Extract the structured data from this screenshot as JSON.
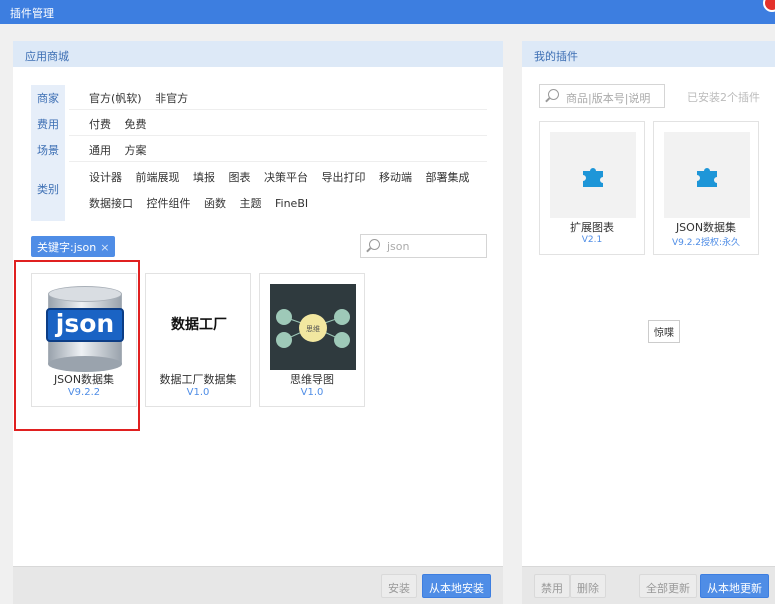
{
  "window": {
    "title": "插件管理"
  },
  "store": {
    "header": "应用商城",
    "filters": [
      {
        "key": "商家",
        "values": [
          "官方(帆软)",
          "非官方"
        ]
      },
      {
        "key": "费用",
        "values": [
          "付费",
          "免费"
        ]
      },
      {
        "key": "场景",
        "values": [
          "通用",
          "方案"
        ]
      },
      {
        "key": "类别",
        "values": [
          "设计器",
          "前端展现",
          "填报",
          "图表",
          "决策平台",
          "导出打印",
          "移动端",
          "部署集成"
        ],
        "values2": [
          "数据接口",
          "控件组件",
          "函数",
          "主题",
          "FineBI"
        ]
      }
    ],
    "keyword_tag": "关键字:json",
    "keyword_close": "×",
    "search_value": "json",
    "plugins": [
      {
        "name": "JSON数据集",
        "version": "V9.2.2",
        "icon": "json-database-icon",
        "thumb_text": "json"
      },
      {
        "name": "数据工厂数据集",
        "version": "V1.0",
        "icon": "data-factory-logo",
        "thumb_text": "数据工厂"
      },
      {
        "name": "思维导图",
        "version": "V1.0",
        "icon": "mind-map-icon",
        "thumb_text": "思维"
      }
    ],
    "footer": {
      "install": "安装",
      "install_local": "从本地安装"
    }
  },
  "mine": {
    "header": "我的插件",
    "search_placeholder": "商品|版本号|说明",
    "installed_count": "已安装2个插件",
    "plugins": [
      {
        "name": "扩展图表",
        "version": "V2.1",
        "icon": "puzzle-icon"
      },
      {
        "name": "JSON数据集",
        "version": "V9.2.2授权:永久",
        "icon": "puzzle-icon"
      }
    ],
    "tooltip": "惊喋",
    "footer": {
      "disable": "禁用",
      "delete": "删除",
      "update_all": "全部更新",
      "update_local": "从本地更新"
    }
  },
  "colors": {
    "accent": "#4f8de6",
    "titlebar": "#3d7ee0",
    "highlight": "#e02020"
  }
}
